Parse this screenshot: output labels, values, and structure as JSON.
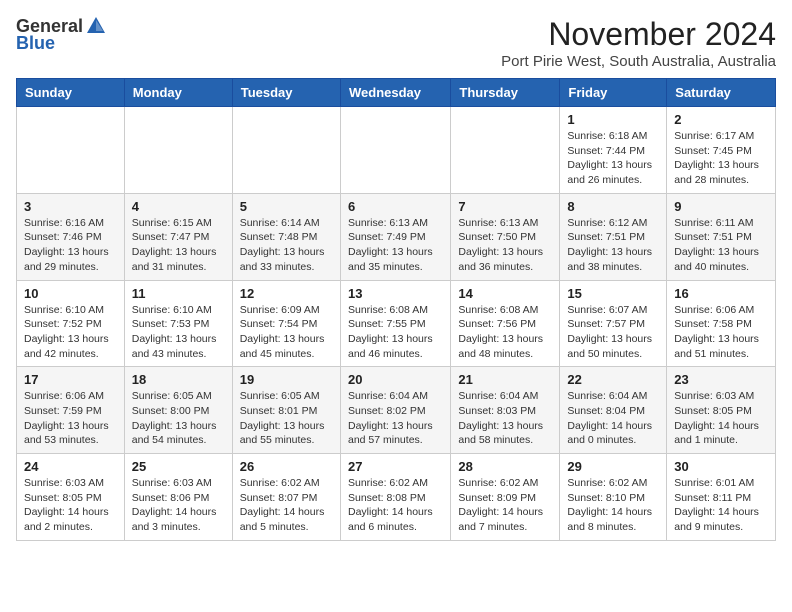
{
  "header": {
    "logo": {
      "general": "General",
      "blue": "Blue",
      "tagline": "General Blue"
    },
    "month": "November 2024",
    "location": "Port Pirie West, South Australia, Australia"
  },
  "weekdays": [
    "Sunday",
    "Monday",
    "Tuesday",
    "Wednesday",
    "Thursday",
    "Friday",
    "Saturday"
  ],
  "weeks": [
    [
      {
        "day": "",
        "info": ""
      },
      {
        "day": "",
        "info": ""
      },
      {
        "day": "",
        "info": ""
      },
      {
        "day": "",
        "info": ""
      },
      {
        "day": "",
        "info": ""
      },
      {
        "day": "1",
        "info": "Sunrise: 6:18 AM\nSunset: 7:44 PM\nDaylight: 13 hours\nand 26 minutes."
      },
      {
        "day": "2",
        "info": "Sunrise: 6:17 AM\nSunset: 7:45 PM\nDaylight: 13 hours\nand 28 minutes."
      }
    ],
    [
      {
        "day": "3",
        "info": "Sunrise: 6:16 AM\nSunset: 7:46 PM\nDaylight: 13 hours\nand 29 minutes."
      },
      {
        "day": "4",
        "info": "Sunrise: 6:15 AM\nSunset: 7:47 PM\nDaylight: 13 hours\nand 31 minutes."
      },
      {
        "day": "5",
        "info": "Sunrise: 6:14 AM\nSunset: 7:48 PM\nDaylight: 13 hours\nand 33 minutes."
      },
      {
        "day": "6",
        "info": "Sunrise: 6:13 AM\nSunset: 7:49 PM\nDaylight: 13 hours\nand 35 minutes."
      },
      {
        "day": "7",
        "info": "Sunrise: 6:13 AM\nSunset: 7:50 PM\nDaylight: 13 hours\nand 36 minutes."
      },
      {
        "day": "8",
        "info": "Sunrise: 6:12 AM\nSunset: 7:51 PM\nDaylight: 13 hours\nand 38 minutes."
      },
      {
        "day": "9",
        "info": "Sunrise: 6:11 AM\nSunset: 7:51 PM\nDaylight: 13 hours\nand 40 minutes."
      }
    ],
    [
      {
        "day": "10",
        "info": "Sunrise: 6:10 AM\nSunset: 7:52 PM\nDaylight: 13 hours\nand 42 minutes."
      },
      {
        "day": "11",
        "info": "Sunrise: 6:10 AM\nSunset: 7:53 PM\nDaylight: 13 hours\nand 43 minutes."
      },
      {
        "day": "12",
        "info": "Sunrise: 6:09 AM\nSunset: 7:54 PM\nDaylight: 13 hours\nand 45 minutes."
      },
      {
        "day": "13",
        "info": "Sunrise: 6:08 AM\nSunset: 7:55 PM\nDaylight: 13 hours\nand 46 minutes."
      },
      {
        "day": "14",
        "info": "Sunrise: 6:08 AM\nSunset: 7:56 PM\nDaylight: 13 hours\nand 48 minutes."
      },
      {
        "day": "15",
        "info": "Sunrise: 6:07 AM\nSunset: 7:57 PM\nDaylight: 13 hours\nand 50 minutes."
      },
      {
        "day": "16",
        "info": "Sunrise: 6:06 AM\nSunset: 7:58 PM\nDaylight: 13 hours\nand 51 minutes."
      }
    ],
    [
      {
        "day": "17",
        "info": "Sunrise: 6:06 AM\nSunset: 7:59 PM\nDaylight: 13 hours\nand 53 minutes."
      },
      {
        "day": "18",
        "info": "Sunrise: 6:05 AM\nSunset: 8:00 PM\nDaylight: 13 hours\nand 54 minutes."
      },
      {
        "day": "19",
        "info": "Sunrise: 6:05 AM\nSunset: 8:01 PM\nDaylight: 13 hours\nand 55 minutes."
      },
      {
        "day": "20",
        "info": "Sunrise: 6:04 AM\nSunset: 8:02 PM\nDaylight: 13 hours\nand 57 minutes."
      },
      {
        "day": "21",
        "info": "Sunrise: 6:04 AM\nSunset: 8:03 PM\nDaylight: 13 hours\nand 58 minutes."
      },
      {
        "day": "22",
        "info": "Sunrise: 6:04 AM\nSunset: 8:04 PM\nDaylight: 14 hours\nand 0 minutes."
      },
      {
        "day": "23",
        "info": "Sunrise: 6:03 AM\nSunset: 8:05 PM\nDaylight: 14 hours\nand 1 minute."
      }
    ],
    [
      {
        "day": "24",
        "info": "Sunrise: 6:03 AM\nSunset: 8:05 PM\nDaylight: 14 hours\nand 2 minutes."
      },
      {
        "day": "25",
        "info": "Sunrise: 6:03 AM\nSunset: 8:06 PM\nDaylight: 14 hours\nand 3 minutes."
      },
      {
        "day": "26",
        "info": "Sunrise: 6:02 AM\nSunset: 8:07 PM\nDaylight: 14 hours\nand 5 minutes."
      },
      {
        "day": "27",
        "info": "Sunrise: 6:02 AM\nSunset: 8:08 PM\nDaylight: 14 hours\nand 6 minutes."
      },
      {
        "day": "28",
        "info": "Sunrise: 6:02 AM\nSunset: 8:09 PM\nDaylight: 14 hours\nand 7 minutes."
      },
      {
        "day": "29",
        "info": "Sunrise: 6:02 AM\nSunset: 8:10 PM\nDaylight: 14 hours\nand 8 minutes."
      },
      {
        "day": "30",
        "info": "Sunrise: 6:01 AM\nSunset: 8:11 PM\nDaylight: 14 hours\nand 9 minutes."
      }
    ]
  ]
}
